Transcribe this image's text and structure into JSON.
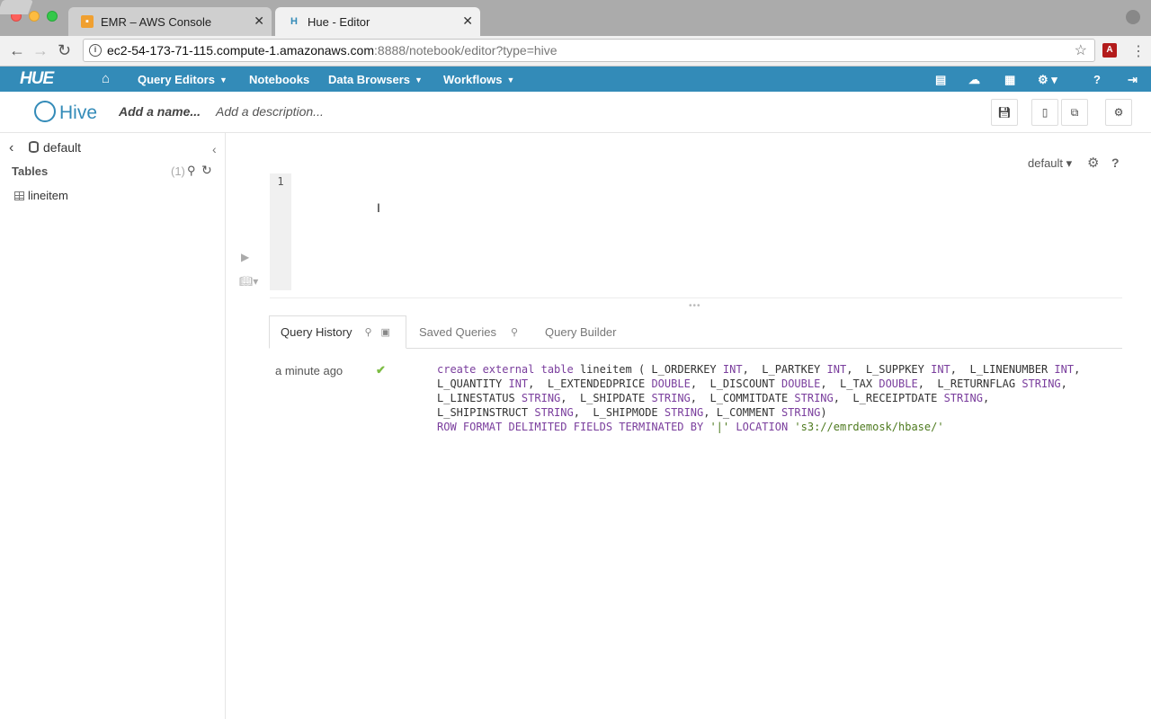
{
  "browser": {
    "tabs": [
      {
        "title": "EMR – AWS Console",
        "active": false
      },
      {
        "title": "Hue - Editor",
        "active": true
      }
    ],
    "url_host": "ec2-54-173-71-115.compute-1.amazonaws.com",
    "url_path": ":8888/notebook/editor?type=hive"
  },
  "hue_nav": {
    "logo": "HUE",
    "items": [
      "Query Editors",
      "Notebooks",
      "Data Browsers",
      "Workflows"
    ]
  },
  "editor_header": {
    "title": "Hive",
    "name_placeholder": "Add a name...",
    "description_placeholder": "Add a description..."
  },
  "assist": {
    "database": "default",
    "tables_label": "Tables",
    "tables_count": "(1)",
    "tables": [
      "lineitem"
    ]
  },
  "editor": {
    "database_select": "default",
    "line_numbers": [
      "1"
    ],
    "content": ""
  },
  "result_tabs": [
    "Query History",
    "Saved Queries",
    "Query Builder"
  ],
  "history": [
    {
      "time": "a minute ago",
      "status": "success",
      "query_lines": [
        "create external table lineitem ( L_ORDERKEY INT,  L_PARTKEY INT,  L_SUPPKEY INT,  L_LINENUMBER INT,",
        "L_QUANTITY INT,  L_EXTENDEDPRICE DOUBLE,  L_DISCOUNT DOUBLE,  L_TAX DOUBLE,  L_RETURNFLAG STRING,",
        "L_LINESTATUS STRING,  L_SHIPDATE STRING,  L_COMMITDATE STRING,  L_RECEIPTDATE STRING,",
        "L_SHIPINSTRUCT STRING,  L_SHIPMODE STRING, L_COMMENT STRING)",
        "ROW FORMAT DELIMITED FIELDS TERMINATED BY '|' LOCATION 's3://emrdemosk/hbase/'"
      ]
    }
  ],
  "colors": {
    "nav_bg": "#338bb8",
    "success": "#7cbc43",
    "keyword": "#7a3e9d",
    "string": "#4e7a1f"
  },
  "icons": [
    "home-icon",
    "file-icon",
    "cloud-icon",
    "table-icon",
    "cogs-icon",
    "help-icon",
    "logout-icon",
    "save-icon",
    "new-doc-icon",
    "tags-icon",
    "settings-icon"
  ]
}
